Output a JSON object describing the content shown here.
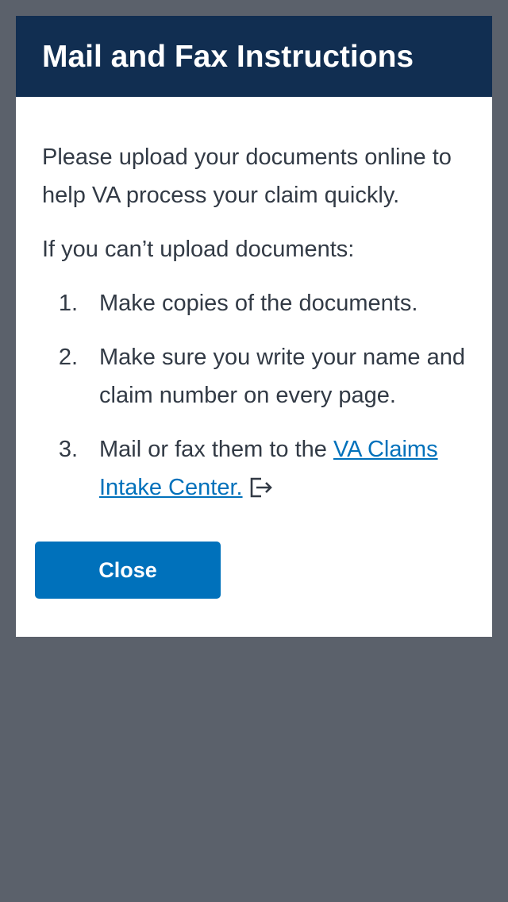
{
  "modal": {
    "title": "Mail and Fax Instructions",
    "intro": "Please upload your documents online to help VA process your claim quickly.",
    "lead": "If you can’t upload documents:",
    "steps": [
      {
        "number": "1.",
        "text": "Make copies of the documents."
      },
      {
        "number": "2.",
        "text": "Make sure you write your name and claim number on every page."
      },
      {
        "number": "3.",
        "text": "Mail or fax them to the ",
        "link": "VA Claims Intake Center."
      }
    ],
    "external_link_icon": "external-link-icon",
    "close_label": "Close"
  },
  "colors": {
    "backdrop": "#5b616b",
    "header": "#112e51",
    "primary": "#0071bb",
    "text": "#323a45"
  }
}
